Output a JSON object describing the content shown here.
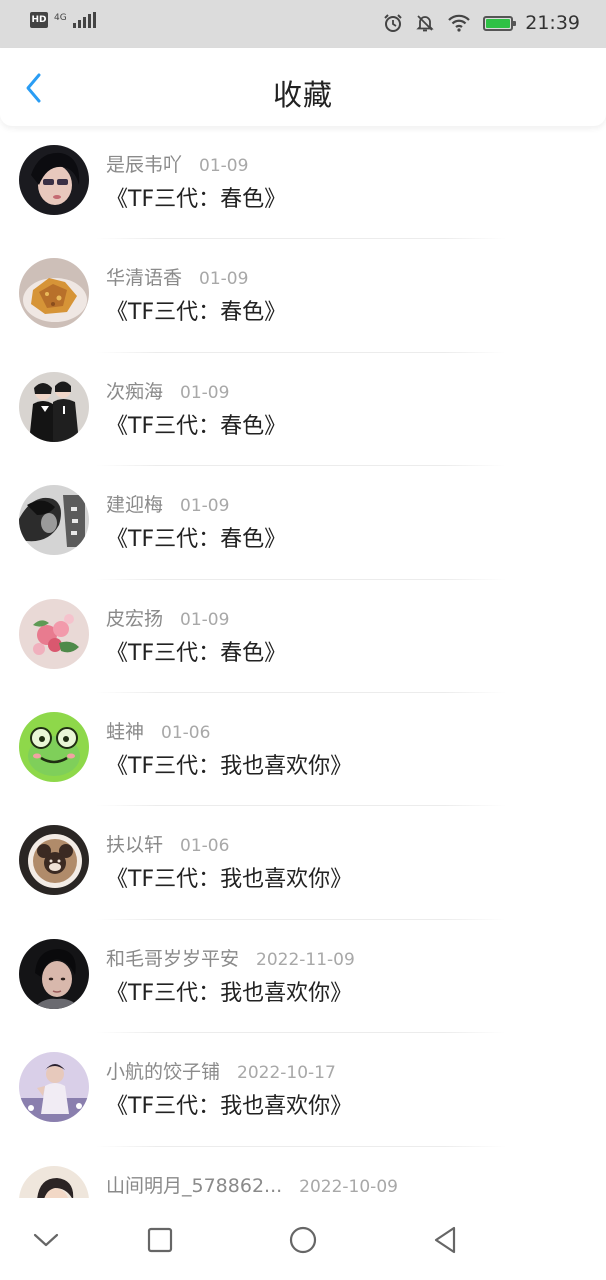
{
  "status_bar": {
    "hd_label": "HD",
    "network_label": "4G",
    "time": "21:39",
    "battery_level": 1.0
  },
  "header": {
    "title": "收藏",
    "back_icon": "chevron-left-icon",
    "accent_color": "#2a9df4"
  },
  "favorites": [
    {
      "user": "是辰韦吖",
      "date": "01-09",
      "title": "《TF三代：春色》"
    },
    {
      "user": "华清语香",
      "date": "01-09",
      "title": "《TF三代：春色》"
    },
    {
      "user": "次痴海",
      "date": "01-09",
      "title": "《TF三代：春色》"
    },
    {
      "user": "建迎梅",
      "date": "01-09",
      "title": "《TF三代：春色》"
    },
    {
      "user": "皮宏扬",
      "date": "01-09",
      "title": "《TF三代：春色》"
    },
    {
      "user": "蛙神",
      "date": "01-06",
      "title": "《TF三代：我也喜欢你》"
    },
    {
      "user": "扶以轩",
      "date": "01-06",
      "title": "《TF三代：我也喜欢你》"
    },
    {
      "user": "和毛哥岁岁平安",
      "date": "2022-11-09",
      "title": "《TF三代：我也喜欢你》"
    },
    {
      "user": "小航的饺子铺",
      "date": "2022-10-17",
      "title": "《TF三代：我也喜欢你》"
    },
    {
      "user": "山间明月_578862...",
      "date": "2022-10-09",
      "title": ""
    }
  ],
  "nav_bar": {
    "icons": [
      "chevron-down-icon",
      "square-icon",
      "circle-icon",
      "triangle-back-icon"
    ]
  }
}
